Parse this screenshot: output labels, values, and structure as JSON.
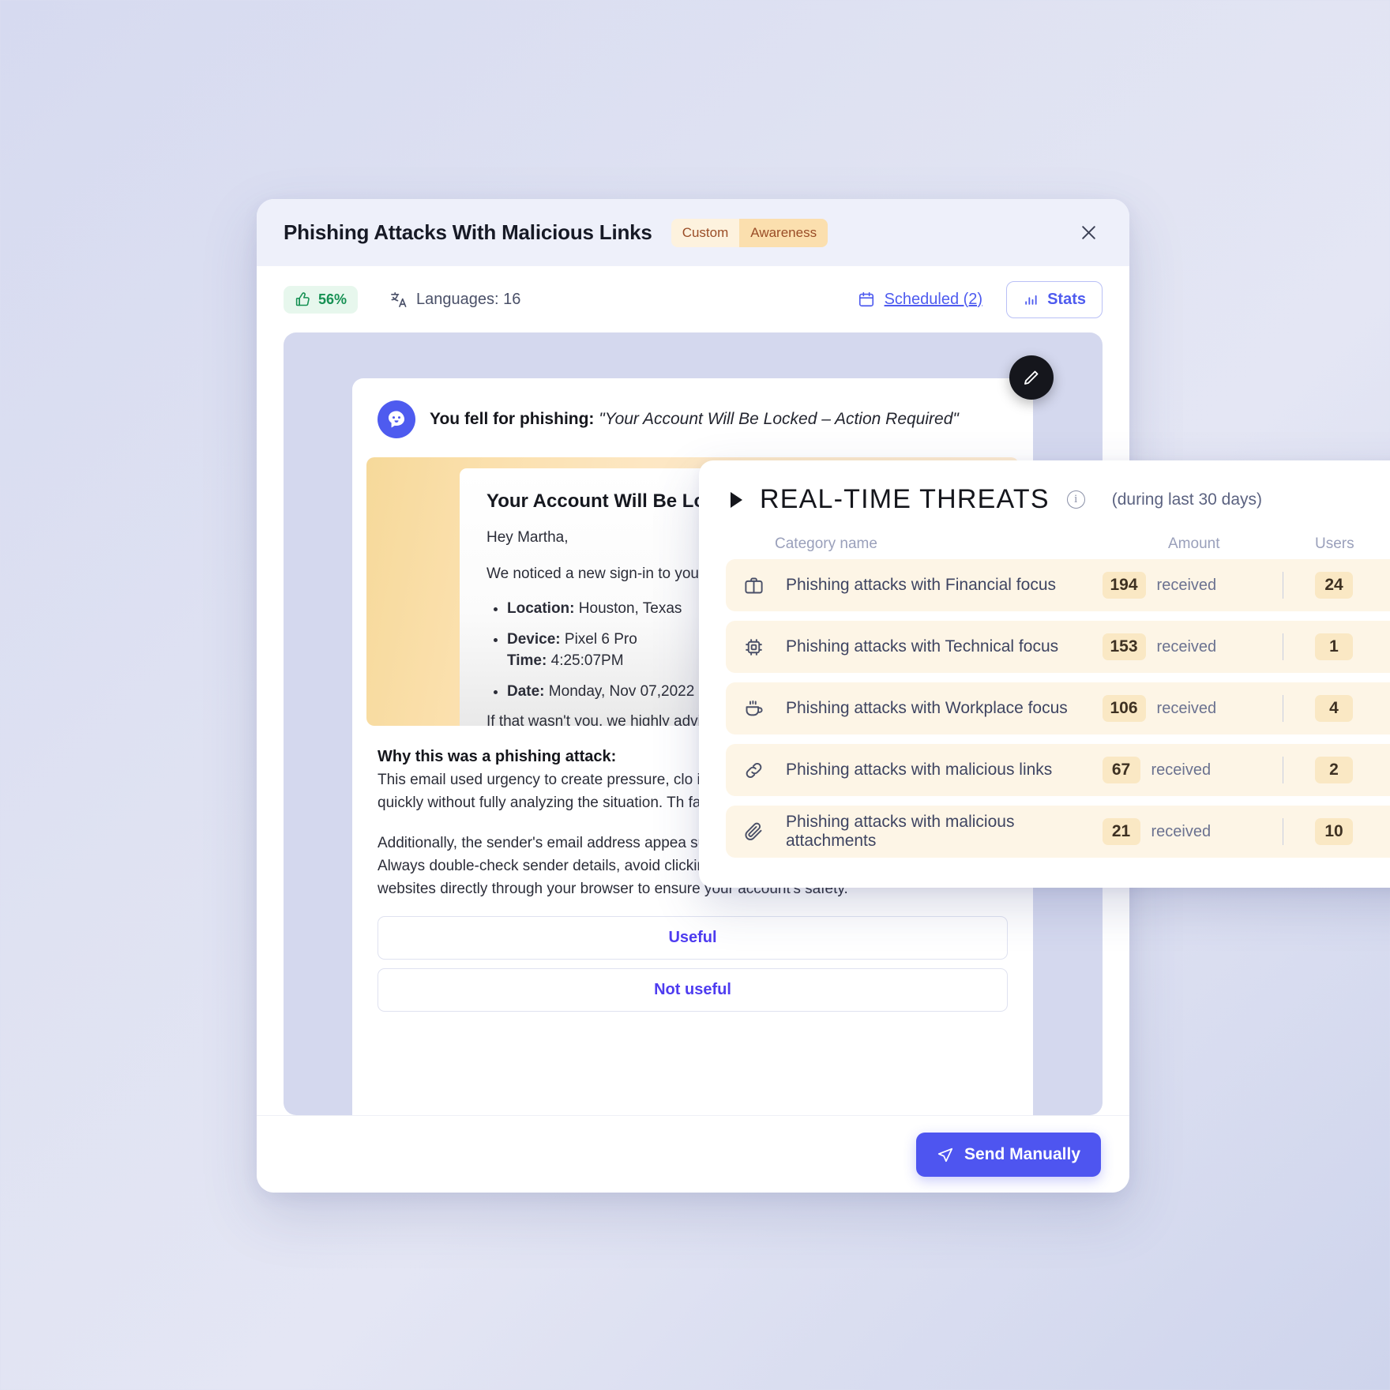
{
  "header": {
    "title": "Phishing Attacks With Malicious Links",
    "tag_custom": "Custom",
    "tag_awareness": "Awareness",
    "close_label": "×"
  },
  "toolbar": {
    "rating": "56%",
    "languages": "Languages: 16",
    "scheduled": "Scheduled (2)",
    "stats": "Stats"
  },
  "preview": {
    "fell_label": "You fell for phishing:",
    "fell_subject": "\"Your Account Will Be Locked – Action Required\"",
    "email": {
      "subject": "Your Account Will Be Lo",
      "greeting": "Hey Martha,",
      "lead": "We noticed a new sign-in to your",
      "items": [
        {
          "label": "Location:",
          "value": "Houston, Texas"
        },
        {
          "label": "Device:",
          "value": "Pixel 6 Pro",
          "label2": "Time:",
          "value2": "4:25:07PM"
        },
        {
          "label": "Date:",
          "value": "Monday, Nov 07,2022"
        }
      ],
      "tail": "If that wasn't you, we highly advi"
    },
    "why_title": "Why this was a phishing attack:",
    "why_body_1": "This email used urgency to create pressure, clo immediate action was taken. Cybercriminals o quickly without fully analyzing the situation. Th fake login page designed to steal your credent",
    "why_body_2": "Additionally, the sender's email address appea subtle misspellings (e.g., \"support@bank-secu Always double-check sender details, avoid clicking on unverified links, and navigate to official websites directly through your browser to ensure your account's safety.",
    "useful": "Useful",
    "not_useful": "Not useful"
  },
  "footer": {
    "send": "Send Manually"
  },
  "threats": {
    "title": "REAL-TIME THREATS",
    "period": "(during last 30 days)",
    "col_category": "Category name",
    "col_amount": "Amount",
    "col_users": "Users",
    "received_label": "received",
    "rows": [
      {
        "icon": "briefcase-icon",
        "name": "Phishing attacks with Financial focus",
        "amount": "194",
        "users": "24"
      },
      {
        "icon": "cpu-icon",
        "name": "Phishing attacks with Technical focus",
        "amount": "153",
        "users": "1"
      },
      {
        "icon": "coffee-icon",
        "name": "Phishing attacks with Workplace focus",
        "amount": "106",
        "users": "4"
      },
      {
        "icon": "link-icon",
        "name": "Phishing attacks with malicious links",
        "amount": "67",
        "users": "2"
      },
      {
        "icon": "paperclip-icon",
        "name": "Phishing attacks with malicious attachments",
        "amount": "21",
        "users": "10"
      }
    ]
  },
  "colors": {
    "accent": "#4e55f0",
    "tag_bg": "#fbdfae",
    "row_bg": "#fdf5e6",
    "success": "#179154"
  }
}
